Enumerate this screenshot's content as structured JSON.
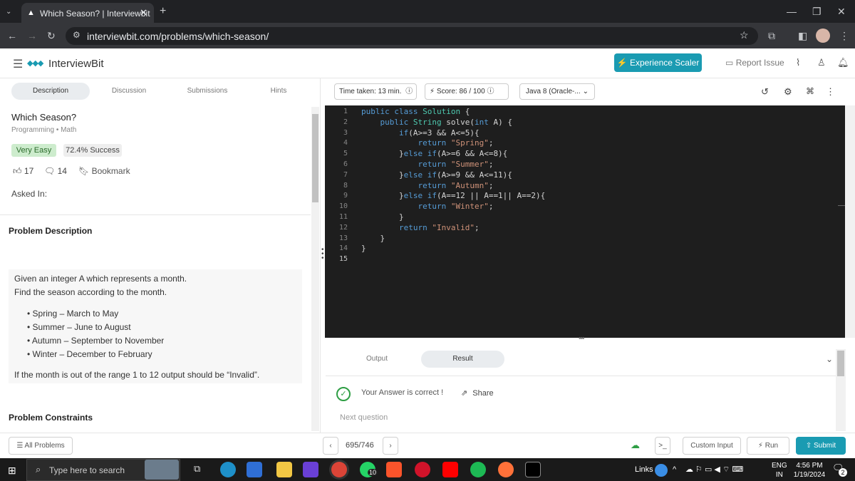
{
  "browser": {
    "tab_title": "Which Season? | Interviewbit",
    "url": "interviewbit.com/problems/which-season/"
  },
  "site": {
    "logo": "InterviewBit",
    "experience_btn": "Experience Scaler",
    "report_issue": "Report Issue"
  },
  "left_tabs": [
    "Description",
    "Discussion",
    "Submissions",
    "Hints"
  ],
  "problem": {
    "title": "Which Season?",
    "category": "Programming",
    "topic": "Math",
    "difficulty": "Very Easy",
    "success": "72.4% Success",
    "likes": "17",
    "comments": "14",
    "bookmark": "Bookmark",
    "asked_in": "Asked In:",
    "desc_heading": "Problem Description",
    "desc_line1": "Given an integer A which represents a month.",
    "desc_line2": "Find the season according to the month.",
    "seasons": [
      "Spring – March to May",
      "Summer – June to August",
      "Autumn – September to November",
      "Winter – December to February"
    ],
    "invalid_note": "If the month is out of the range 1 to 12 output should be “Invalid”.",
    "constraints_heading": "Problem Constraints"
  },
  "editor_toolbar": {
    "time_taken": "Time taken: 13 min.",
    "score": "Score: 86",
    "score_total": "/ 100",
    "language": "Java 8 (Oracle-..."
  },
  "code": {
    "line_numbers": [
      "1",
      "2",
      "3",
      "4",
      "5",
      "6",
      "7",
      "8",
      "9",
      "10",
      "11",
      "12",
      "13",
      "14",
      "15"
    ]
  },
  "output": {
    "tabs": [
      "Output",
      "Result"
    ],
    "message": "Your Answer is correct !",
    "share": "Share",
    "next": "Next question"
  },
  "bottom": {
    "all_problems": "All Problems",
    "page": "695/746",
    "custom_input": "Custom Input",
    "run": "Run",
    "submit": "Submit"
  },
  "taskbar": {
    "search_placeholder": "Type here to search",
    "links": "Links",
    "lang": "ENG",
    "region": "IN",
    "time": "4:56 PM",
    "date": "1/19/2024",
    "whatsapp_badge": "10",
    "notif_count": "2"
  },
  "colors": {
    "accent": "#1a9bb2",
    "success_green": "#2e9e44",
    "very_easy_bg": "#cdeccd"
  }
}
